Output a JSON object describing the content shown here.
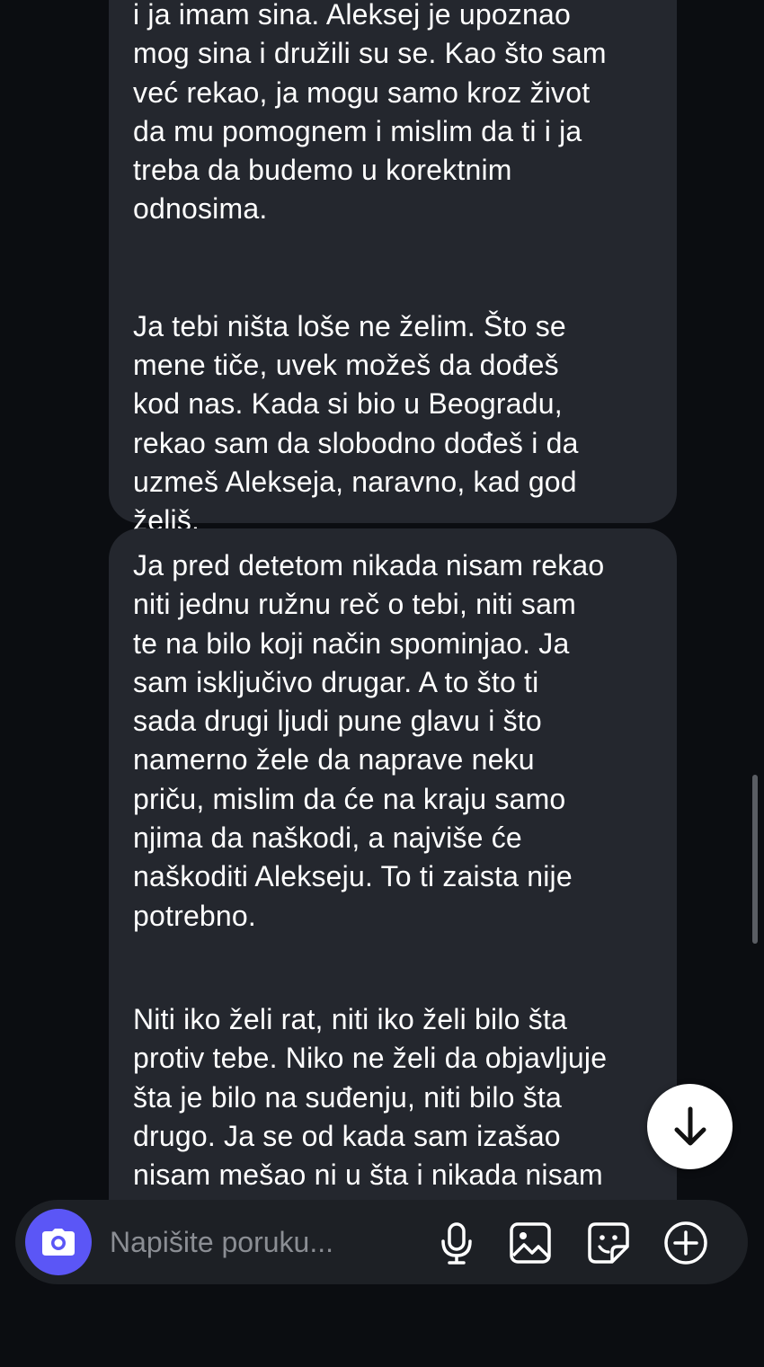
{
  "messages": [
    {
      "paragraphs": [
        "i ja imam sina. Aleksej je upoznao\nmog sina i družili su se. Kao što sam\nveć rekao, ja mogu samo kroz život\nda mu pomognem i mislim da ti i ja\ntreba da budemo u korektnim\nodnosima.",
        "Ja tebi ništa loše ne želim. Što se\nmene tiče, uvek možeš da dođeš\nkod nas. Kada si bio u Beogradu,\nrekao sam da slobodno dođeš i da\nuzmeš Alekseja, naravno, kad god\nželiš."
      ]
    },
    {
      "paragraphs": [
        "Ja pred detetom nikada nisam rekao\nniti jednu ružnu reč o tebi, niti sam\nte na bilo koji način spominjao. Ja\nsam isključivo drugar. A to što ti\nsada drugi ljudi pune glavu i što\nnamerno žele da naprave neku\npriču, mislim da će na kraju samo\nnjima da naškodi, a najviše će\nnaškoditi Alekseju. To ti zaista nije\npotrebno.",
        "Niti iko želi rat, niti iko želi bilo šta\nprotiv tebe. Niko ne želi da objavljuje\nšta je bilo na suđenju, niti bilo šta\ndrugo. Ja se od kada sam izašao\nnisam mešao ni u šta i nikada nisam\nželeo da se mešam."
      ]
    }
  ],
  "composer": {
    "placeholder": "Napišite poruku...",
    "camera_icon": "camera-icon",
    "tools": [
      "microphone-icon",
      "image-icon",
      "sticker-icon",
      "plus-circle-icon"
    ]
  },
  "scroll_down_icon": "arrow-down-icon",
  "colors": {
    "background": "#0b0d11",
    "bubble": "#24272e",
    "composer": "#1d2025",
    "accent": "#5b56f6",
    "text": "#ffffff",
    "placeholder": "#8b8e94"
  }
}
